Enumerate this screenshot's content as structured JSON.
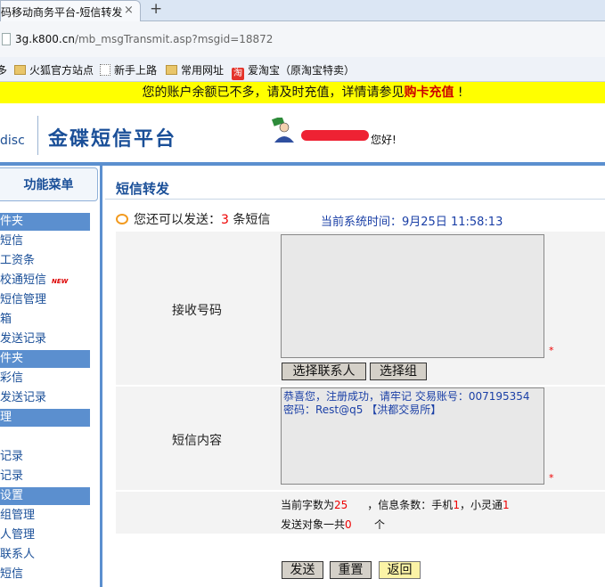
{
  "browser": {
    "tab_title": "码移动商务平台-短信转发",
    "tab_close": "×",
    "new_tab": "+",
    "url_host": "3g.k800.cn",
    "url_path": "/mb_msgTransmit.asp?msgid=18872",
    "bookmarks": [
      "多",
      "火狐官方站点",
      "新手上路",
      "常用网址",
      "爱淘宝（原淘宝特卖）"
    ],
    "taobao_glyph": "淘"
  },
  "notice": {
    "text": "您的账户余额已不多，请及时充值，详情请参见",
    "link": "购卡充值",
    "suffix": " !"
  },
  "header": {
    "logo_fragment": "disc",
    "site_title": "金碟短信平台",
    "greeting": "您好!"
  },
  "sidebar": {
    "title": "功能菜单",
    "rows": [
      {
        "label": "件夹",
        "type": "section"
      },
      {
        "label": "短信",
        "type": "item"
      },
      {
        "label": "工资条",
        "type": "item"
      },
      {
        "label": "校通短信",
        "type": "item",
        "badge": "NEW"
      },
      {
        "label": "短信管理",
        "type": "item"
      },
      {
        "label": "箱",
        "type": "item"
      },
      {
        "label": "发送记录",
        "type": "item"
      },
      {
        "label": "件夹",
        "type": "section"
      },
      {
        "label": "彩信",
        "type": "item"
      },
      {
        "label": "发送记录",
        "type": "item"
      },
      {
        "label": "理",
        "type": "section"
      },
      {
        "label": "",
        "type": "item"
      },
      {
        "label": "记录",
        "type": "item"
      },
      {
        "label": "记录",
        "type": "item"
      },
      {
        "label": "设置",
        "type": "section"
      },
      {
        "label": "组管理",
        "type": "item"
      },
      {
        "label": "人管理",
        "type": "item"
      },
      {
        "label": "联系人",
        "type": "item"
      },
      {
        "label": "短信",
        "type": "item"
      }
    ]
  },
  "main": {
    "title": "短信转发",
    "remaining_prefix": "您还可以发送：",
    "remaining_count": "3",
    "remaining_suffix": " 条短信",
    "system_time_label": "当前系统时间：",
    "system_time": "9月25日 11:58:13",
    "receiver_label": "接收号码",
    "receiver_value": "",
    "required_mark": "*",
    "choose_contact_button": "选择联系人",
    "choose_group_button": "选择组",
    "content_label": "短信内容",
    "content_value": "恭喜您，注册成功，请牢记 交易账号：007195354\n密码：Rest@q5 【洪都交易所】",
    "char_count_label": "当前字数为",
    "char_count": "25",
    "msg_count_label": "，信息条数：手机",
    "msg_count_mobile": "1",
    "msg_count_xlt_label": "，小灵通",
    "msg_count_xlt": "1",
    "target_label": "发送对象一共",
    "target_count": "0",
    "target_unit": "个",
    "send_button": "发送",
    "reset_button": "重置",
    "back_button": "返回"
  },
  "colors": {
    "accent": "#5b8fcf",
    "title_blue": "#1a4f98",
    "notice_bg": "#ffff00",
    "warning_red": "#ee0000"
  }
}
